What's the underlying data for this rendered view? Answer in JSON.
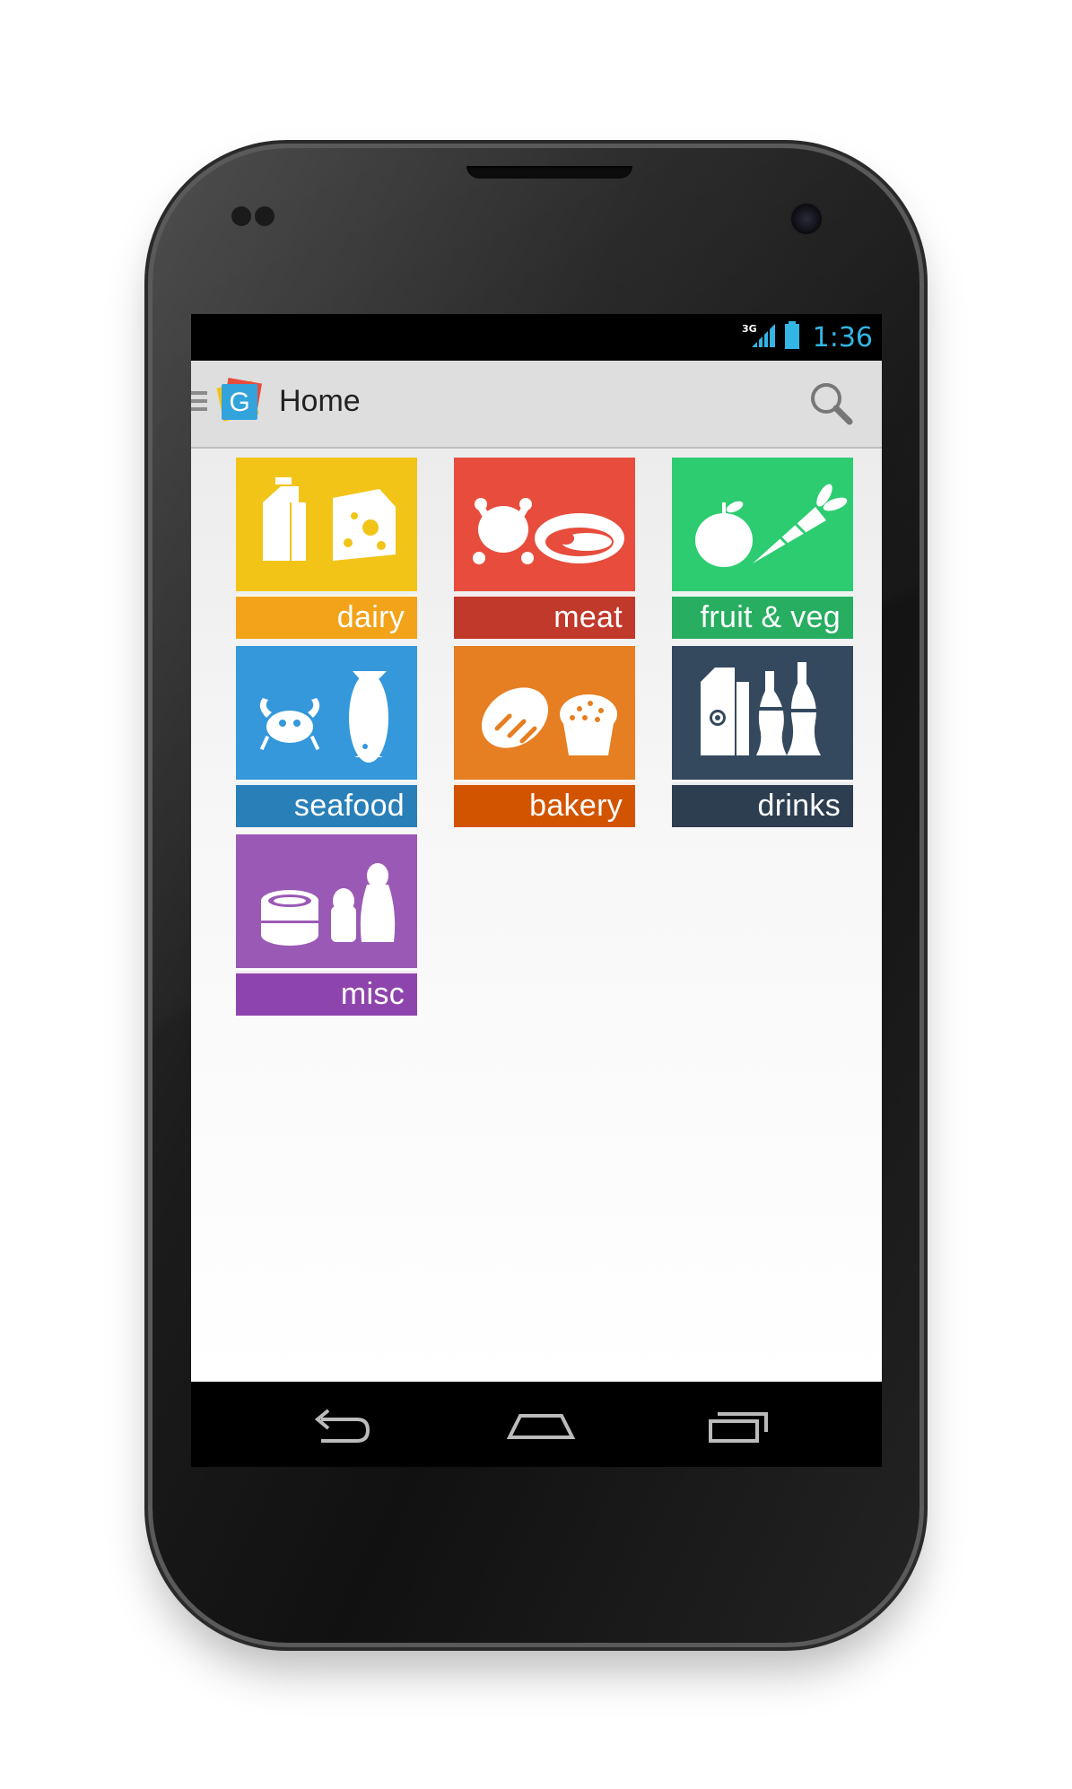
{
  "status_bar": {
    "network_type": "3G",
    "time": "1:36",
    "icons": [
      "signal-icon",
      "battery-icon"
    ]
  },
  "action_bar": {
    "title": "Home",
    "app_icon_letter": "G",
    "icons": [
      "drawer-icon",
      "app-icon",
      "search-icon"
    ]
  },
  "categories": [
    {
      "label": "dairy",
      "icon": "dairy-icon",
      "color": "#f2c418",
      "bar_color": "#f2a31a"
    },
    {
      "label": "meat",
      "icon": "meat-icon",
      "color": "#e74c3c",
      "bar_color": "#c0392b"
    },
    {
      "label": "fruit & veg",
      "icon": "fruit-veg-icon",
      "color": "#2ecc71",
      "bar_color": "#27ae60"
    },
    {
      "label": "seafood",
      "icon": "seafood-icon",
      "color": "#3498db",
      "bar_color": "#2980b9"
    },
    {
      "label": "bakery",
      "icon": "bakery-icon",
      "color": "#e67e22",
      "bar_color": "#d35400"
    },
    {
      "label": "drinks",
      "icon": "drinks-icon",
      "color": "#34495e",
      "bar_color": "#2c3e50"
    },
    {
      "label": "misc",
      "icon": "misc-icon",
      "color": "#9b59b6",
      "bar_color": "#8e44ad"
    }
  ],
  "nav_bar": {
    "icons": [
      "back-icon",
      "home-icon",
      "recent-apps-icon"
    ]
  },
  "theme": {
    "accent": "#33b5e5",
    "action_bar_bg": "#dedede"
  }
}
